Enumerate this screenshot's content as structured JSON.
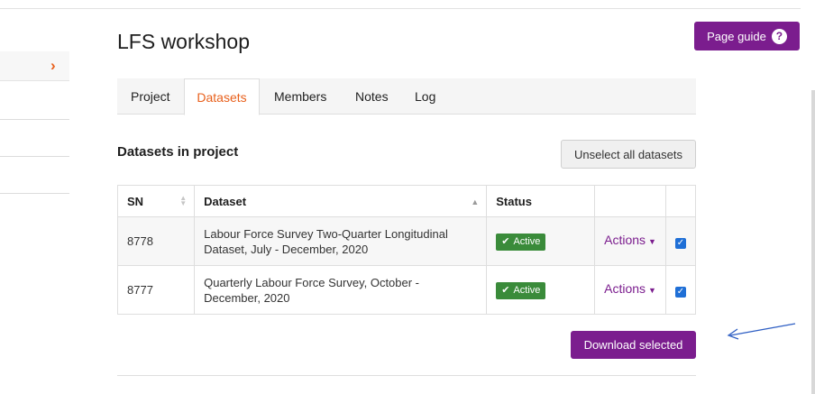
{
  "page": {
    "title": "LFS workshop"
  },
  "guide": {
    "label": "Page guide",
    "icon": "question-circle-icon"
  },
  "sidebar": {
    "chevron_icon": "chevron-right-icon",
    "chevron_glyph": "›"
  },
  "tabs": [
    {
      "label": "Project",
      "active": false
    },
    {
      "label": "Datasets",
      "active": true
    },
    {
      "label": "Members",
      "active": false
    },
    {
      "label": "Notes",
      "active": false
    },
    {
      "label": "Log",
      "active": false
    }
  ],
  "section": {
    "title": "Datasets in project"
  },
  "unselect": {
    "label": "Unselect all datasets"
  },
  "table": {
    "headers": [
      "SN",
      "Dataset",
      "Status",
      "",
      ""
    ],
    "rows": [
      {
        "sn": "8778",
        "dataset": "Labour Force Survey Two-Quarter Longitudinal Dataset, July - December, 2020",
        "status": "Active",
        "actions": "Actions",
        "checked": true
      },
      {
        "sn": "8777",
        "dataset": "Quarterly Labour Force Survey, October - December, 2020",
        "status": "Active",
        "actions": "Actions",
        "checked": true
      }
    ]
  },
  "download": {
    "label": "Download selected"
  },
  "colors": {
    "brand": "#7b1d8e",
    "accent": "#e8601c",
    "active_badge": "#3a8b3a",
    "checkbox": "#1f6fd6",
    "annotation_arrow": "#2f5fc4"
  }
}
